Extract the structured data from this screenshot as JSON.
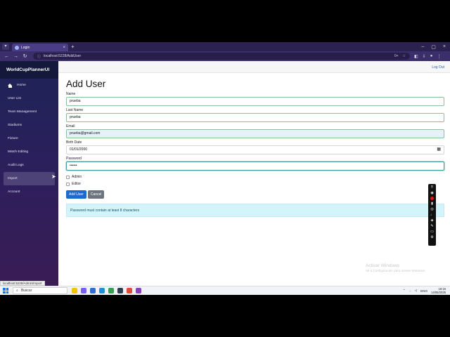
{
  "browser": {
    "tab_title": "Login",
    "url": "localhost:5228/AddUser",
    "zoom_indicator": "0+"
  },
  "app": {
    "brand": "WorldCupPlannerUI",
    "logout_label": "Log Out",
    "nav": [
      {
        "label": "Home"
      },
      {
        "label": "User List"
      },
      {
        "label": "Team Management"
      },
      {
        "label": "Stadiums"
      },
      {
        "label": "Fixture"
      },
      {
        "label": "Match Editing"
      },
      {
        "label": "Audit Logs"
      },
      {
        "label": "Import"
      },
      {
        "label": "Account"
      }
    ]
  },
  "form": {
    "title": "Add User",
    "name_label": "Name",
    "name_value": "prueba",
    "last_name_label": "Last Name",
    "last_name_value": "prueba",
    "email_label": "Email",
    "email_value": "prueba@gmail.com",
    "birth_label": "Birth Date",
    "birth_value": "01/01/2000",
    "password_label": "Password",
    "password_value": "••••••",
    "admin_label": "Admin",
    "editor_label": "Editor",
    "add_button": "Add User",
    "cancel_button": "Cancel",
    "alert": "Password must contain at least 8 characters"
  },
  "status_url": "localhost:5228/Admin/Import",
  "watermark": {
    "title": "Activar Windows",
    "subtitle": "Ve a Configuración para activar Windows."
  },
  "taskbar": {
    "search_placeholder": "Buscar",
    "lang": "ENG",
    "time": "18:16",
    "date": "14/05/2025"
  }
}
